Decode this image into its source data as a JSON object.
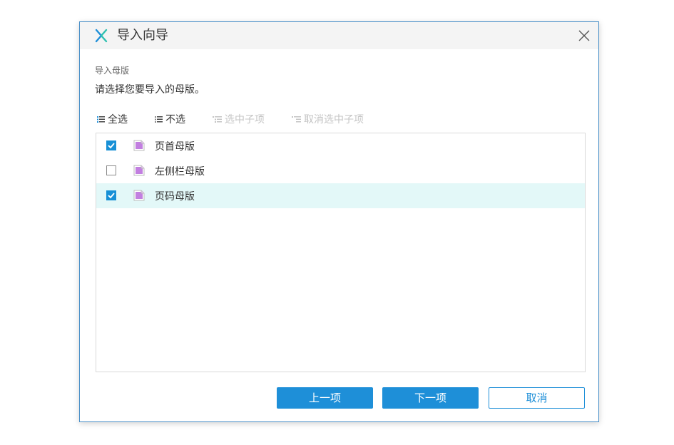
{
  "dialog": {
    "title": "导入向导",
    "section_label": "导入母版",
    "instruction": "请选择您要导入的母版。"
  },
  "toolbar": {
    "select_all": "全选",
    "select_none": "不选",
    "select_children": "选中子项",
    "deselect_children": "取消选中子项"
  },
  "items": [
    {
      "label": "页首母版",
      "checked": true
    },
    {
      "label": "左侧栏母版",
      "checked": false
    },
    {
      "label": "页码母版",
      "checked": true
    }
  ],
  "buttons": {
    "prev": "上一项",
    "next": "下一项",
    "cancel": "取消"
  },
  "icons": {
    "logo": "axure-x-logo-icon",
    "close": "close-icon",
    "list": "list-icon",
    "file": "master-file-icon",
    "check": "check-icon"
  },
  "colors": {
    "accent": "#1e8fd8",
    "selected_row": "#e3f8f8",
    "file_icon": "#c27fe0"
  }
}
